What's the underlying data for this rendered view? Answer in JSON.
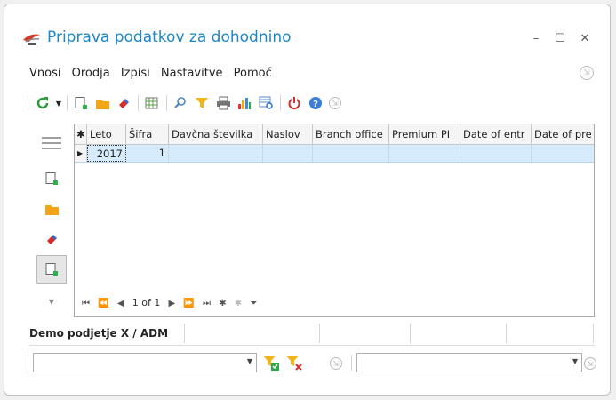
{
  "window": {
    "title": "Priprava podatkov za dohodnino"
  },
  "menu": {
    "items": [
      "Vnosi",
      "Orodja",
      "Izpisi",
      "Nastavitve",
      "Pomoč"
    ]
  },
  "grid": {
    "columns": [
      "Leto",
      "Šifra",
      "Davčna številka",
      "Naslov",
      "Branch office",
      "Premium PI",
      "Date of entr",
      "Date of pre"
    ],
    "rows": [
      [
        "2017",
        "1",
        "",
        "",
        "",
        "",
        "",
        ""
      ]
    ],
    "pager": {
      "page_text": "1 of 1"
    }
  },
  "tabs": {
    "active_label": "Demo podjetje X / ADM"
  },
  "colors": {
    "accent": "#1d87c8",
    "row_selected": "#d6ebfb"
  }
}
